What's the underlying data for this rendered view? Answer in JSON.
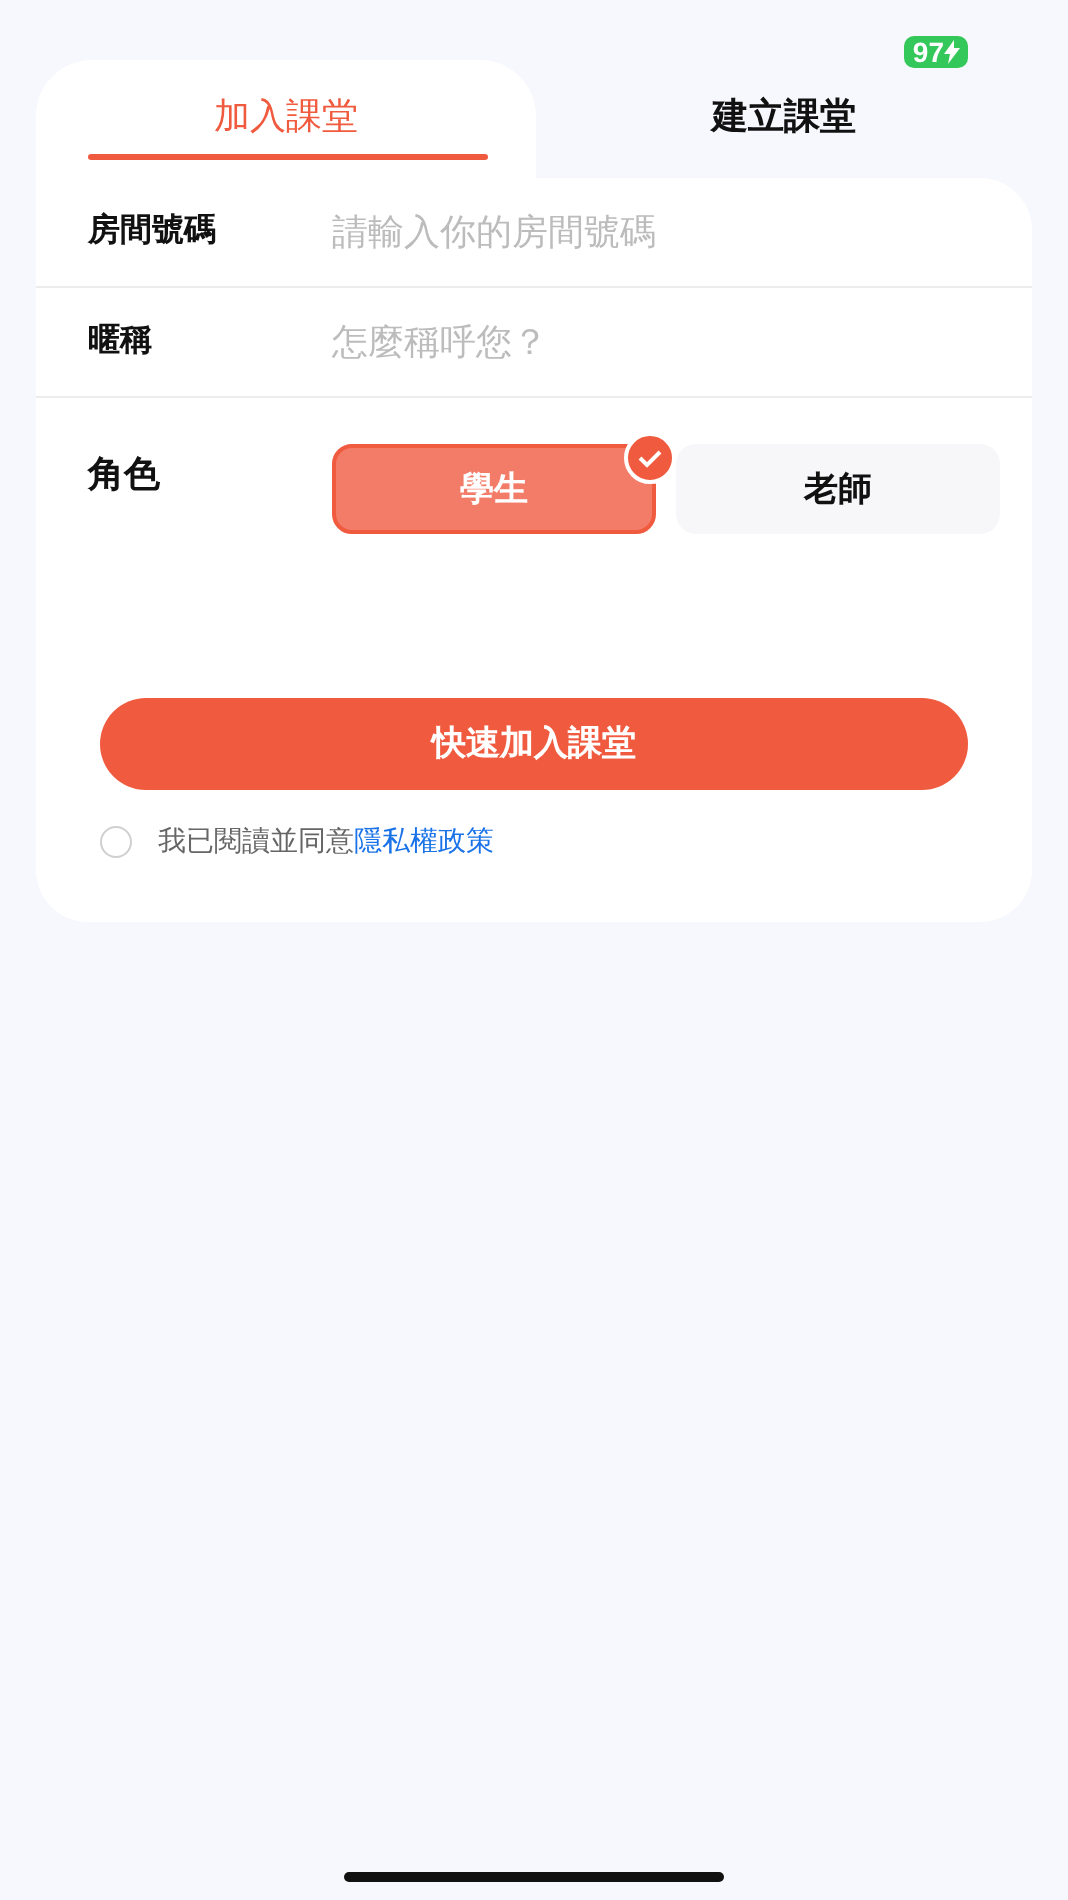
{
  "status_bar": {
    "battery": "97"
  },
  "tabs": [
    {
      "label": "加入課堂",
      "selected": true
    },
    {
      "label": "建立課堂",
      "selected": false
    }
  ],
  "fields": [
    {
      "label": "房間號碼",
      "placeholder": "請輸入你的房間號碼"
    },
    {
      "label": "暱稱",
      "placeholder": "怎麼稱呼您？"
    }
  ],
  "role": {
    "label": "角色",
    "options": [
      {
        "label": "學生",
        "selected": true
      },
      {
        "label": "老師",
        "selected": false
      }
    ]
  },
  "submit_button": "快速加入課堂",
  "agreement": {
    "checked": false,
    "text": "我已閱讀並同意",
    "link": "隱私權政策"
  }
}
